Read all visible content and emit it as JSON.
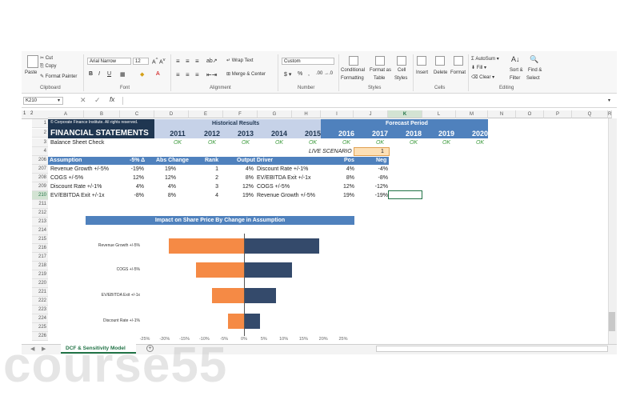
{
  "ribbon": {
    "clipboard": {
      "paste": "Paste",
      "cut": "Cut",
      "copy": "Copy",
      "format_painter": "Format Painter",
      "group": "Clipboard"
    },
    "font": {
      "name": "Arial Narrow",
      "size": "12",
      "group": "Font"
    },
    "alignment": {
      "wrap_text": "Wrap Text",
      "merge_center": "Merge & Center",
      "group": "Alignment"
    },
    "number": {
      "format": "Custom",
      "group": "Number"
    },
    "styles": {
      "conditional": "Conditional",
      "formatting": "Formatting",
      "format_as": "Format as",
      "table": "Table",
      "cell": "Cell",
      "cell_styles": "Styles",
      "group": "Styles"
    },
    "cells": {
      "insert": "Insert",
      "delete": "Delete",
      "format": "Format",
      "group": "Cells"
    },
    "editing": {
      "autosum": "AutoSum",
      "fill": "Fill",
      "clear": "Clear",
      "sort": "Sort &",
      "filter": "Filter",
      "find": "Find &",
      "select": "Select",
      "group": "Editing"
    }
  },
  "formula_bar": {
    "name_box": "K210",
    "fx": "fx",
    "content": ""
  },
  "column_headers": [
    "A",
    "B",
    "C",
    "D",
    "E",
    "F",
    "G",
    "H",
    "I",
    "J",
    "K",
    "L",
    "M",
    "N",
    "O",
    "P",
    "Q",
    "R"
  ],
  "row_numbers": [
    "1",
    "2",
    "3",
    "4",
    "206",
    "207",
    "208",
    "209",
    "210",
    "211",
    "212",
    "213",
    "214",
    "215",
    "216",
    "217",
    "218",
    "219",
    "220",
    "221",
    "222",
    "223",
    "224",
    "225",
    "226"
  ],
  "sheet": {
    "copyright": "© Corporate Finance Institute. All rights reserved.",
    "title": "FINANCIAL STATEMENTS",
    "historical": "Historical Results",
    "forecast": "Forecast Period",
    "years": [
      "2011",
      "2012",
      "2013",
      "2014",
      "2015",
      "2016",
      "2017",
      "2018",
      "2019",
      "2020"
    ],
    "balance_check": "Balance Sheet Check",
    "ok": "OK",
    "live_scenario": "LIVE SCENARIO",
    "live_value": "1"
  },
  "sensitivity": {
    "headers": {
      "assumption": "Assumption",
      "delta": "-5% Δ",
      "abs_change": "Abs Change",
      "rank": "Rank",
      "output_driver": "Output Driver",
      "pos": "Pos",
      "neg": "Neg"
    },
    "rows": [
      {
        "assumption": "Revenue Growth +/-5%",
        "delta": "-19%",
        "abs": "19%",
        "rank": "1",
        "out_val": "4%",
        "driver": "Discount Rate +/-1%",
        "pos": "4%",
        "neg": "-4%"
      },
      {
        "assumption": "COGS +/-5%",
        "delta": "12%",
        "abs": "12%",
        "rank": "2",
        "out_val": "8%",
        "driver": "EV/EBITDA Exit +/-1x",
        "pos": "8%",
        "neg": "-8%"
      },
      {
        "assumption": "Discount Rate +/-1%",
        "delta": "4%",
        "abs": "4%",
        "rank": "3",
        "out_val": "12%",
        "driver": "COGS +/-5%",
        "pos": "12%",
        "neg": "-12%"
      },
      {
        "assumption": "EV/EBITDA Exit +/-1x",
        "delta": "-8%",
        "abs": "8%",
        "rank": "4",
        "out_val": "19%",
        "driver": "Revenue Growth +/-5%",
        "pos": "19%",
        "neg": "-19%"
      }
    ]
  },
  "chart_data": {
    "type": "bar",
    "orientation": "horizontal-tornado",
    "title": "Impact on Share Price By Change in Assumption",
    "categories": [
      "Revenue Growth +/-5%",
      "COGS +/-5%",
      "EV/EBITDA Exit +/-1x",
      "Discount Rate +/-1%"
    ],
    "series": [
      {
        "name": "",
        "color": "#f58a45",
        "values": [
          -19,
          -12,
          -8,
          -4
        ]
      },
      {
        "name": "",
        "color": "#344a6b",
        "values": [
          19,
          12,
          8,
          4
        ]
      }
    ],
    "xlim": [
      -25,
      25
    ],
    "xticks": [
      "-25%",
      "-20%",
      "-15%",
      "-10%",
      "-5%",
      "0%",
      "5%",
      "10%",
      "15%",
      "20%",
      "25%"
    ]
  },
  "tabs": {
    "active": "DCF & Sensitivity Model",
    "add": "+"
  },
  "watermark": "course55",
  "colors": {
    "header_blue": "#4f81bd",
    "header_light": "#c6d2e8",
    "dark_blue": "#1f3651",
    "ok_green": "#3a9a3a",
    "orange": "#f58a45",
    "navy": "#344a6b"
  }
}
